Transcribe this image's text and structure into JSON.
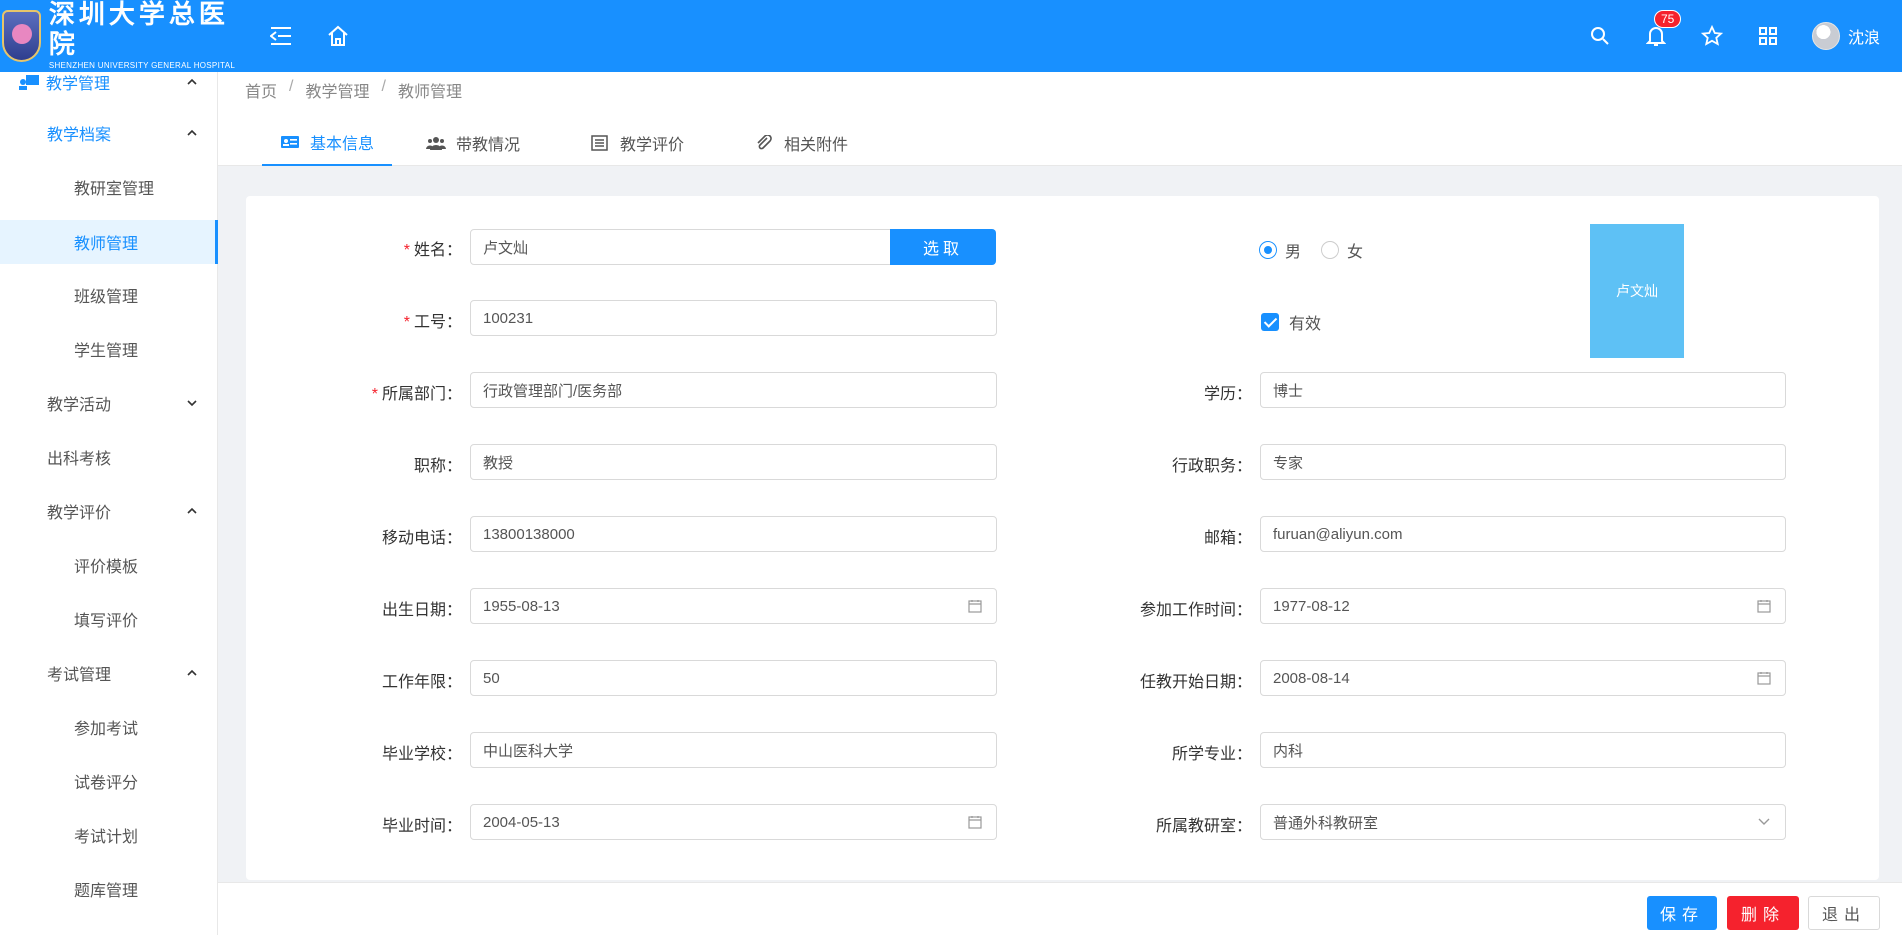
{
  "header": {
    "logo_cn": "深圳大学总医院",
    "logo_en": "SHENZHEN UNIVERSITY GENERAL HOSPITAL",
    "notification_count": "75",
    "user_name": "沈浪"
  },
  "sidebar": {
    "top": "教学管理",
    "items": [
      {
        "label": "教学档案",
        "level": 1
      },
      {
        "label": "教研室管理",
        "level": 2
      },
      {
        "label": "教师管理",
        "level": 2
      },
      {
        "label": "班级管理",
        "level": 2
      },
      {
        "label": "学生管理",
        "level": 2
      },
      {
        "label": "教学活动",
        "level": 1
      },
      {
        "label": "出科考核",
        "level": 1
      },
      {
        "label": "教学评价",
        "level": 1
      },
      {
        "label": "评价模板",
        "level": 2
      },
      {
        "label": "填写评价",
        "level": 2
      },
      {
        "label": "考试管理",
        "level": 1
      },
      {
        "label": "参加考试",
        "level": 2
      },
      {
        "label": "试卷评分",
        "level": 2
      },
      {
        "label": "考试计划",
        "level": 2
      },
      {
        "label": "题库管理",
        "level": 2
      }
    ]
  },
  "breadcrumb": [
    "首页",
    "教学管理",
    "教师管理"
  ],
  "breadcrumb_sep": "/",
  "tabs": [
    "基本信息",
    "带教情况",
    "教学评价",
    "相关附件"
  ],
  "form": {
    "name_label": "姓名",
    "name_value": "卢文灿",
    "pick_label": "选取",
    "gender_male": "男",
    "gender_female": "女",
    "valid_label": "有效",
    "photo_text": "卢文灿",
    "empno_label": "工号",
    "empno_value": "100231",
    "dept_label": "所属部门",
    "dept_value": "行政管理部门/医务部",
    "edu_label": "学历",
    "edu_value": "博士",
    "title_label": "职称",
    "title_value": "教授",
    "admin_label": "行政职务",
    "admin_value": "专家",
    "mobile_label": "移动电话",
    "mobile_value": "13800138000",
    "email_label": "邮箱",
    "email_value": "furuan@aliyun.com",
    "birth_label": "出生日期",
    "birth_value": "1955-08-13",
    "work_start_label": "参加工作时间",
    "work_start_value": "1977-08-12",
    "work_years_label": "工作年限",
    "work_years_value": "50",
    "teach_start_label": "任教开始日期",
    "teach_start_value": "2008-08-14",
    "school_label": "毕业学校",
    "school_value": "中山医科大学",
    "major_label": "所学专业",
    "major_value": "内科",
    "grad_label": "毕业时间",
    "grad_value": "2004-05-13",
    "office_label": "所属教研室",
    "office_value": "普通外科教研室",
    "colon": "："
  },
  "footer": {
    "save": "保存",
    "delete": "删除",
    "exit": "退出"
  },
  "colors": {
    "primary": "#1890ff",
    "danger": "#f5222d",
    "photo": "#5ec1f5"
  }
}
